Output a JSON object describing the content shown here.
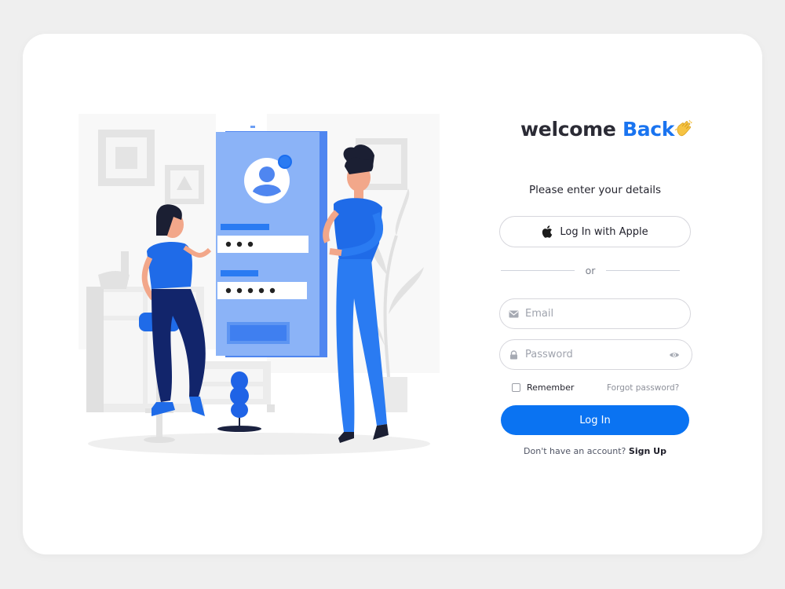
{
  "heading": {
    "part1": "welcome",
    "part2": "Back"
  },
  "subtitle": "Please enter your details",
  "apple_button": {
    "label": "Log In with Apple"
  },
  "divider": {
    "label": "or"
  },
  "email": {
    "placeholder": "Email",
    "value": ""
  },
  "password": {
    "placeholder": "Password",
    "value": ""
  },
  "remember": {
    "label": "Remember",
    "checked": false
  },
  "forgot": {
    "label": "Forgot password?"
  },
  "login_button": {
    "label": "Log In"
  },
  "signup": {
    "prompt": "Don't have an account?",
    "link": "Sign Up"
  },
  "colors": {
    "accent": "#0a73f2",
    "brand_blue": "#1a74f0",
    "background": "#efefef",
    "card": "#ffffff"
  },
  "icons": [
    "waving-hand-icon",
    "apple-icon",
    "mail-icon",
    "lock-icon",
    "eye-icon"
  ]
}
